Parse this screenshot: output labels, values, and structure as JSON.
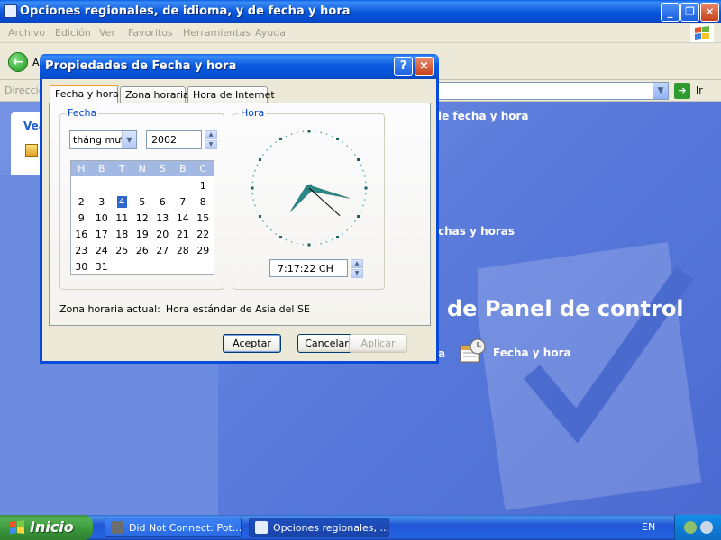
{
  "background_window": {
    "title": "Opciones regionales, de idioma, y de fecha y hora",
    "menu": [
      "Archivo",
      "Edición",
      "Ver",
      "Favoritos",
      "Herramientas",
      "Ayuda"
    ],
    "back_label": "A",
    "address_label": "Direcció",
    "go_label": "Ir",
    "left_panel_title": "Vea",
    "header_1": "le fecha y hora",
    "header_2": "chas y horas",
    "big_heading": "de Panel de control",
    "task_left_fragment": "a",
    "task_fecha": "Fecha y hora"
  },
  "taskbar": {
    "start_label": "Inicio",
    "items": [
      {
        "label": "Did Not Connect: Pot..."
      },
      {
        "label": "Opciones regionales, ..."
      }
    ],
    "language": "EN"
  },
  "dialog": {
    "title": "Propiedades de Fecha y hora",
    "help": "?",
    "close": "×",
    "tabs": [
      {
        "label": "Fecha y hora",
        "active": true
      },
      {
        "label": "Zona horaria",
        "active": false
      },
      {
        "label": "Hora de Internet",
        "active": false
      }
    ],
    "fecha_group_label": "Fecha",
    "hora_group_label": "Hora",
    "month_value": "tháng mười",
    "year_value": "2002",
    "calendar": {
      "day_headers": [
        "H",
        "B",
        "T",
        "N",
        "S",
        "B",
        "C"
      ],
      "weeks": [
        [
          "",
          "",
          "",
          "",
          "",
          "",
          "1"
        ],
        [
          "2",
          "3",
          "4",
          "5",
          "6",
          "7",
          "8"
        ],
        [
          "9",
          "10",
          "11",
          "12",
          "13",
          "14",
          "15"
        ],
        [
          "16",
          "17",
          "18",
          "19",
          "20",
          "21",
          "22"
        ],
        [
          "23",
          "24",
          "25",
          "26",
          "27",
          "28",
          "29"
        ],
        [
          "30",
          "31",
          "",
          "",
          "",
          "",
          ""
        ]
      ],
      "selected_day": "4"
    },
    "clock": {
      "hour": 7,
      "minute": 17,
      "second": 22
    },
    "time_value": "7:17:22 CH",
    "timezone_label": "Zona horaria actual:",
    "timezone_value": "Hora estándar de Asia del SE",
    "buttons": {
      "ok": "Aceptar",
      "cancel": "Cancelar",
      "apply": "Aplicar"
    }
  },
  "colors": {
    "titlebar_blue": "#0a5ae0",
    "group_label_blue": "#0046d5",
    "calendar_selection": "#2f66cc",
    "clock_hands": "#2a8a8a"
  }
}
